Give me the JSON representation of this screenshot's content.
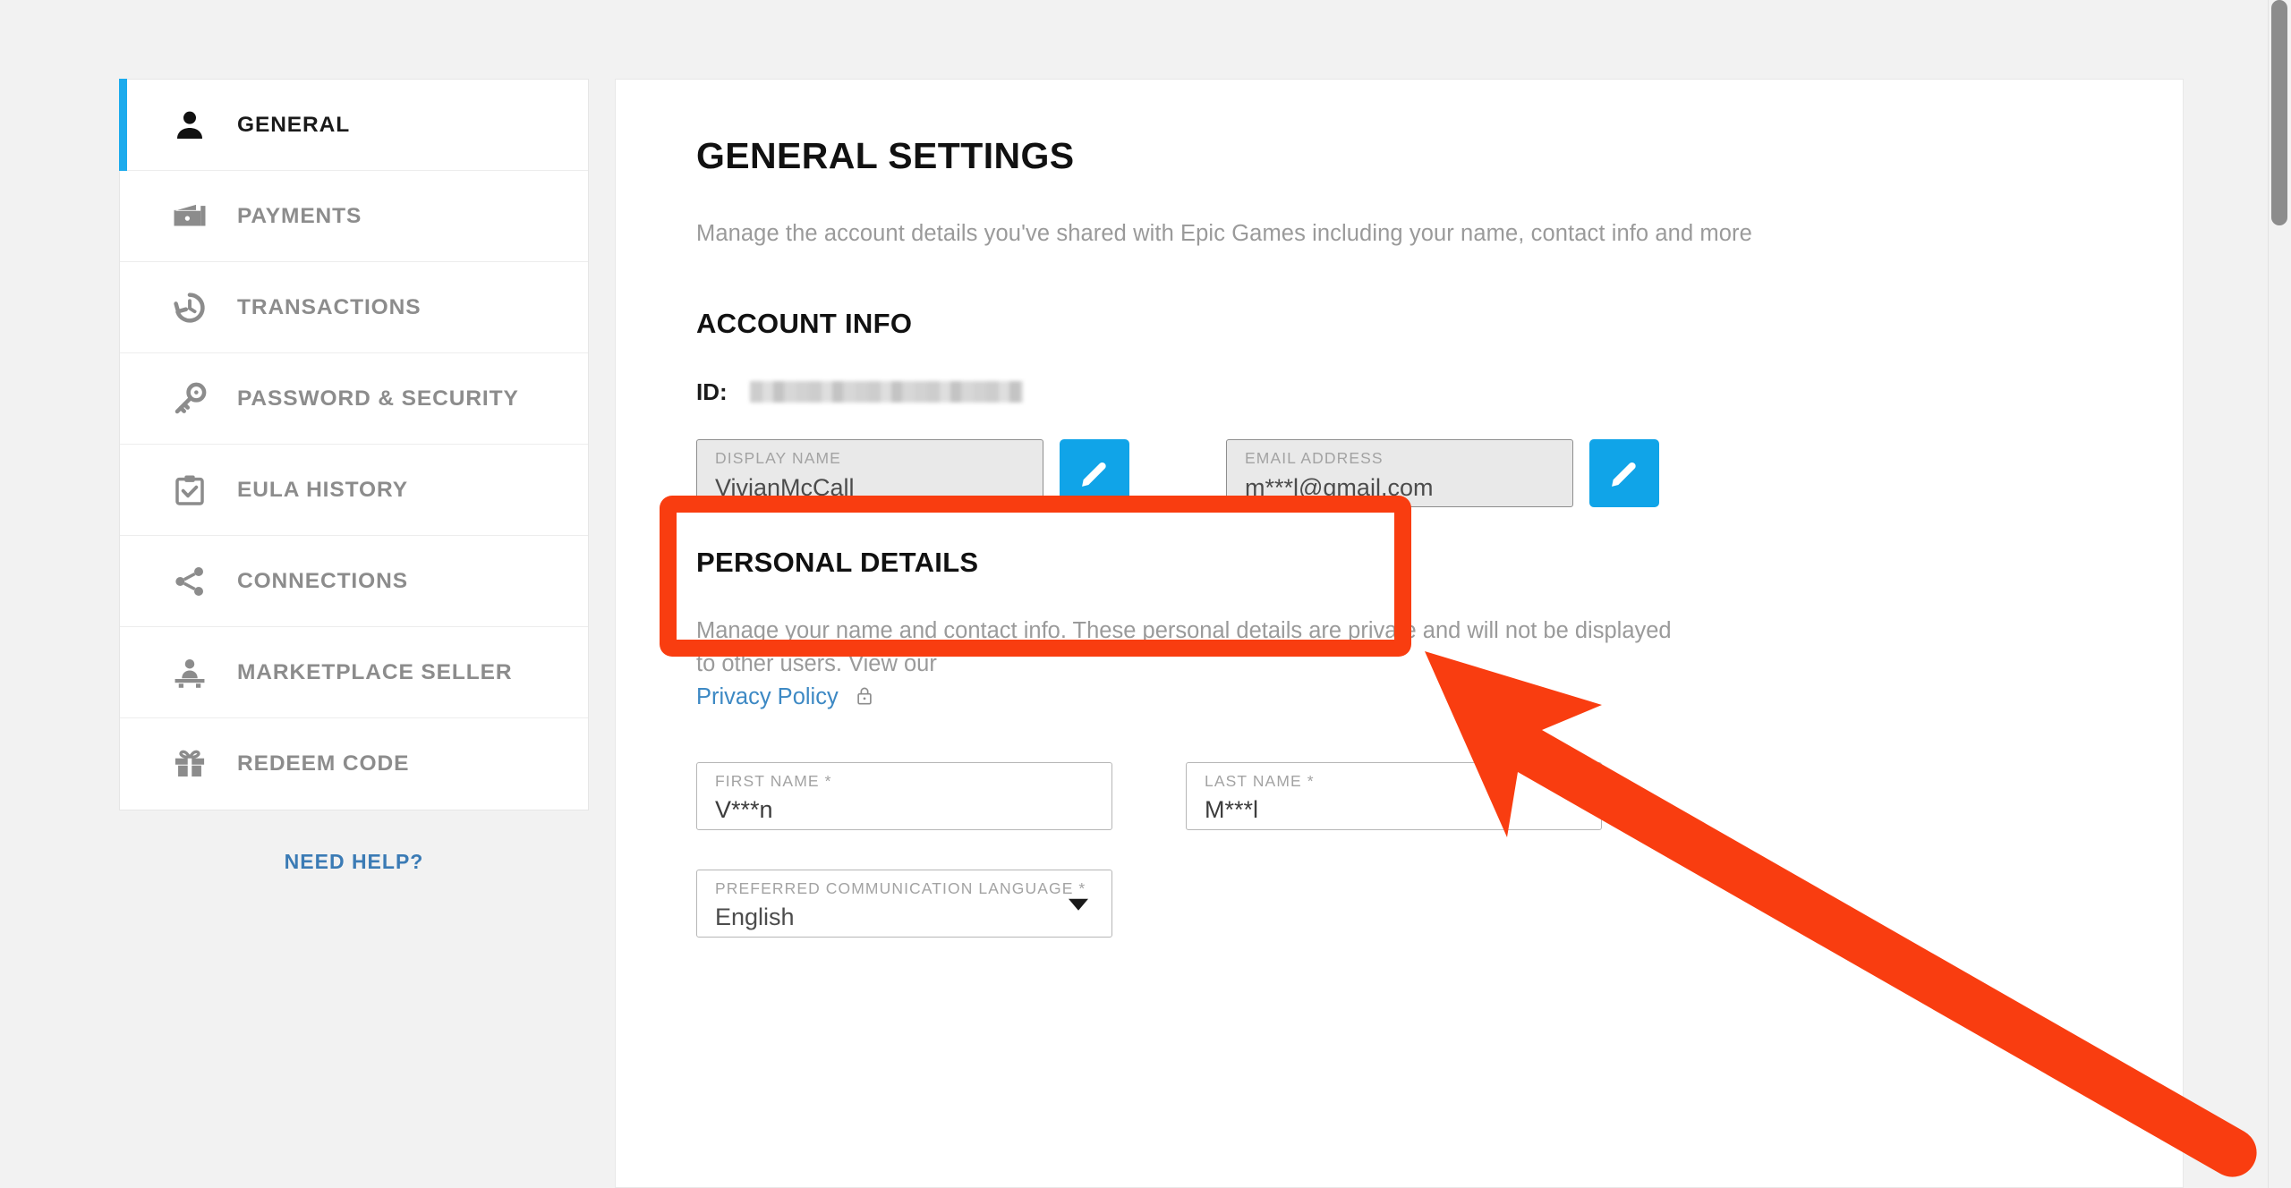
{
  "sidebar": {
    "items": [
      {
        "label": "GENERAL",
        "icon": "person-icon",
        "active": true
      },
      {
        "label": "PAYMENTS",
        "icon": "wallet-icon",
        "active": false
      },
      {
        "label": "TRANSACTIONS",
        "icon": "history-icon",
        "active": false
      },
      {
        "label": "PASSWORD & SECURITY",
        "icon": "key-icon",
        "active": false
      },
      {
        "label": "EULA HISTORY",
        "icon": "clipboard-check-icon",
        "active": false
      },
      {
        "label": "CONNECTIONS",
        "icon": "share-icon",
        "active": false
      },
      {
        "label": "MARKETPLACE SELLER",
        "icon": "seller-icon",
        "active": false
      },
      {
        "label": "REDEEM CODE",
        "icon": "gift-icon",
        "active": false
      }
    ],
    "need_help": "NEED HELP?"
  },
  "main": {
    "title": "GENERAL SETTINGS",
    "subtitle": "Manage the account details you've shared with Epic Games including your name, contact info and more",
    "account_info": {
      "heading": "ACCOUNT INFO",
      "id_label": "ID:",
      "id_value": "",
      "display_name": {
        "label": "DISPLAY NAME",
        "value": "VivianMcCall",
        "edit_icon": "pencil-icon"
      },
      "email": {
        "label": "EMAIL ADDRESS",
        "value": "m***l@gmail.com",
        "edit_icon": "pencil-icon"
      }
    },
    "personal_details": {
      "heading": "PERSONAL DETAILS",
      "description": "Manage your name and contact info. These personal details are private and will not be displayed to other users. View our",
      "privacy_link": "Privacy Policy",
      "privacy_icon": "lock-icon",
      "first_name": {
        "label": "FIRST NAME *",
        "value": "V***n"
      },
      "last_name": {
        "label": "LAST NAME *",
        "value": "M***l"
      },
      "language": {
        "label": "PREFERRED COMMUNICATION LANGUAGE *",
        "value": "English",
        "caret_icon": "chevron-down-icon"
      }
    }
  },
  "annotations": {
    "highlight_color": "#f93d10",
    "arrow_color": "#f93d10",
    "target": "display-name-field"
  },
  "colors": {
    "accent_blue": "#10a4e8",
    "active_bar": "#1cabed",
    "link_blue": "#3d89c4",
    "page_bg": "#f2f2f2"
  },
  "scrollbar": {
    "position": "top"
  }
}
